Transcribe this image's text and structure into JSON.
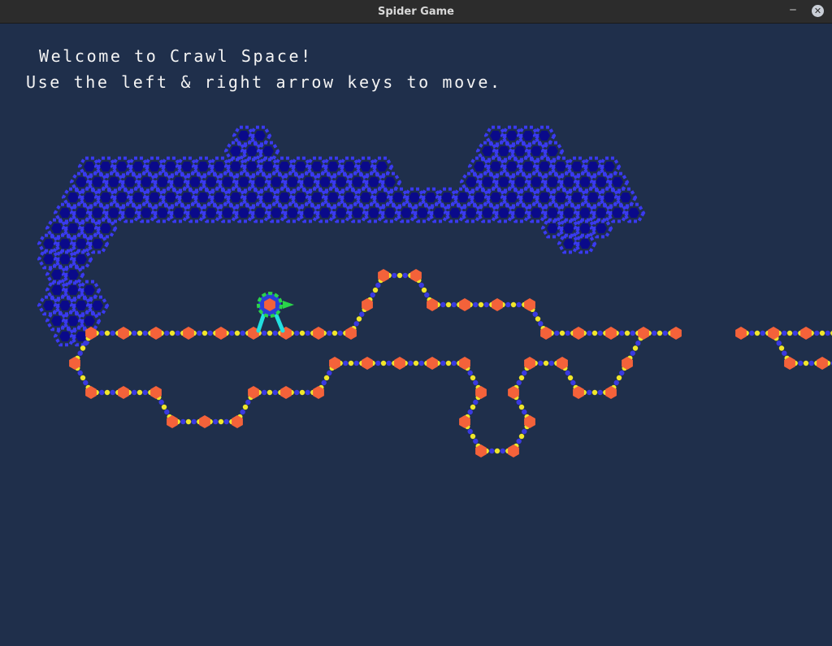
{
  "window": {
    "title": "Spider Game",
    "minimize_glyph": "‒",
    "close_glyph": "✕"
  },
  "game": {
    "welcome_text": "Welcome to Crawl Space!",
    "instructions_text": "Use the left & right arrow keys to move."
  },
  "colors": {
    "background": "#1f2f4b",
    "wall_dark": "#0a0a8a",
    "wall_light": "#3a3af0",
    "node": "#f4623a",
    "thread_a": "#f0e62a",
    "thread_b": "#3a3ae0",
    "spider_body": "#f4623a",
    "spider_ring": "#2ad44a",
    "spider_legs": "#22e0e0"
  },
  "icons": {
    "minimize": "minimize-icon",
    "close": "close-icon",
    "player": "spider-icon"
  }
}
